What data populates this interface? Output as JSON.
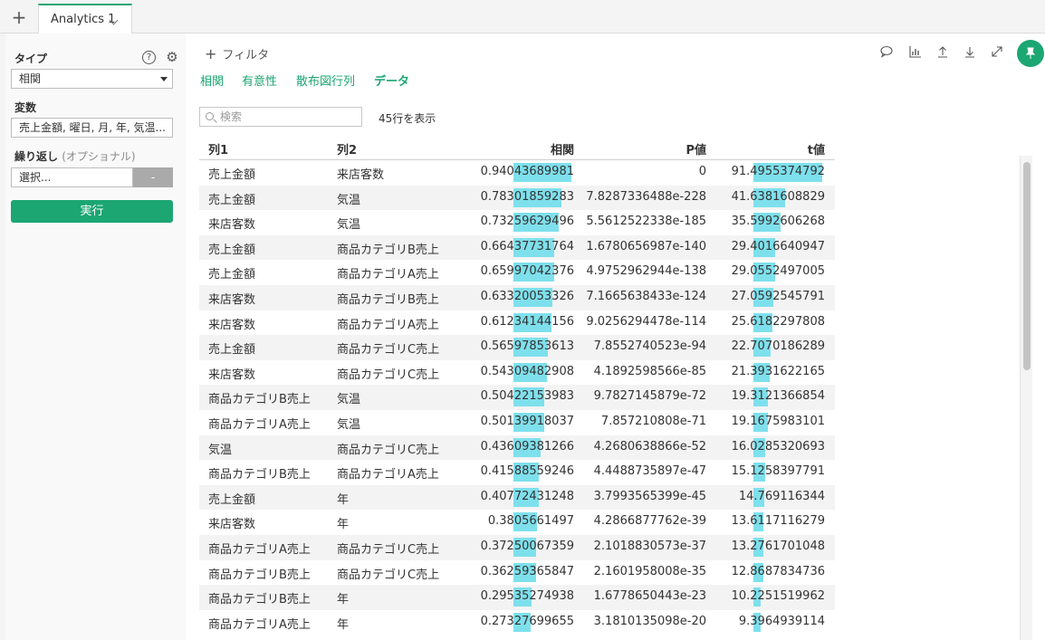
{
  "tabbar": {
    "add_label": "+",
    "tab_label": "Analytics 1"
  },
  "sidebar": {
    "type_label": "タイプ",
    "type_value": "相関",
    "help_glyph": "?",
    "gear_glyph": "⚙",
    "variables_label": "変数",
    "variables_value": "売上金額, 曜日, 月, 年, 気温...",
    "repeat_label": "繰り返し",
    "repeat_optional": "(オプショナル)",
    "repeat_placeholder": "選択...",
    "repeat_button": "-",
    "run_label": "実行"
  },
  "main": {
    "filter_label": "フィルタ",
    "subtabs": [
      "相関",
      "有意性",
      "散布図行列",
      "データ"
    ],
    "active_subtab": "データ",
    "search_placeholder": "検索",
    "row_count": "45行を表示",
    "toolbar_icons": [
      "comment-icon",
      "chart-icon",
      "upload-icon",
      "download-icon",
      "expand-icon",
      "pin-icon"
    ]
  },
  "table": {
    "headers": [
      "列1",
      "列2",
      "相関",
      "P値",
      "t値"
    ],
    "rows": [
      [
        "売上金額",
        "来店客数",
        "0.94043689981",
        "0",
        "91.4955374792"
      ],
      [
        "売上金額",
        "気温",
        "0.78301859283",
        "7.8287336488e-228",
        "41.6381608829"
      ],
      [
        "来店客数",
        "気温",
        "0.73259629496",
        "5.5612522338e-185",
        "35.5992606268"
      ],
      [
        "売上金額",
        "商品カテゴリB売上",
        "0.66437731764",
        "1.6780656987e-140",
        "29.4016640947"
      ],
      [
        "売上金額",
        "商品カテゴリA売上",
        "0.65997042376",
        "4.9752962944e-138",
        "29.0552497005"
      ],
      [
        "来店客数",
        "商品カテゴリB売上",
        "0.63320053326",
        "7.1665638433e-124",
        "27.0592545791"
      ],
      [
        "来店客数",
        "商品カテゴリA売上",
        "0.61234144156",
        "9.0256294478e-114",
        "25.6182297808"
      ],
      [
        "売上金額",
        "商品カテゴリC売上",
        "0.56597853613",
        "7.8552740523e-94",
        "22.7070186289"
      ],
      [
        "来店客数",
        "商品カテゴリC売上",
        "0.54309482908",
        "4.1892598566e-85",
        "21.3931622165"
      ],
      [
        "商品カテゴリB売上",
        "気温",
        "0.50422153983",
        "9.7827145879e-72",
        "19.3121366854"
      ],
      [
        "商品カテゴリA売上",
        "気温",
        "0.50139918037",
        "7.857210808e-71",
        "19.1675983101"
      ],
      [
        "気温",
        "商品カテゴリC売上",
        "0.43609381266",
        "4.2680638866e-52",
        "16.0285320693"
      ],
      [
        "商品カテゴリB売上",
        "商品カテゴリA売上",
        "0.41588559246",
        "4.4488735897e-47",
        "15.1258397791"
      ],
      [
        "売上金額",
        "年",
        "0.40772431248",
        "3.7993565399e-45",
        "14.769116344"
      ],
      [
        "来店客数",
        "年",
        "0.3805661497",
        "4.2866877762e-39",
        "13.6117116279"
      ],
      [
        "商品カテゴリA売上",
        "商品カテゴリC売上",
        "0.37250067359",
        "2.1018830573e-37",
        "13.2761701048"
      ],
      [
        "商品カテゴリB売上",
        "商品カテゴリC売上",
        "0.36259365847",
        "2.1601958008e-35",
        "12.8687834736"
      ],
      [
        "商品カテゴリB売上",
        "年",
        "0.29535274938",
        "1.6778650443e-23",
        "10.2251519962"
      ],
      [
        "商品カテゴリA売上",
        "年",
        "0.27327699655",
        "3.1810135098e-20",
        "9.3964939114"
      ]
    ],
    "bar_color": "#7ee0ec"
  },
  "colors": {
    "accent": "#1ba672",
    "bar": "#7ee0ec"
  }
}
